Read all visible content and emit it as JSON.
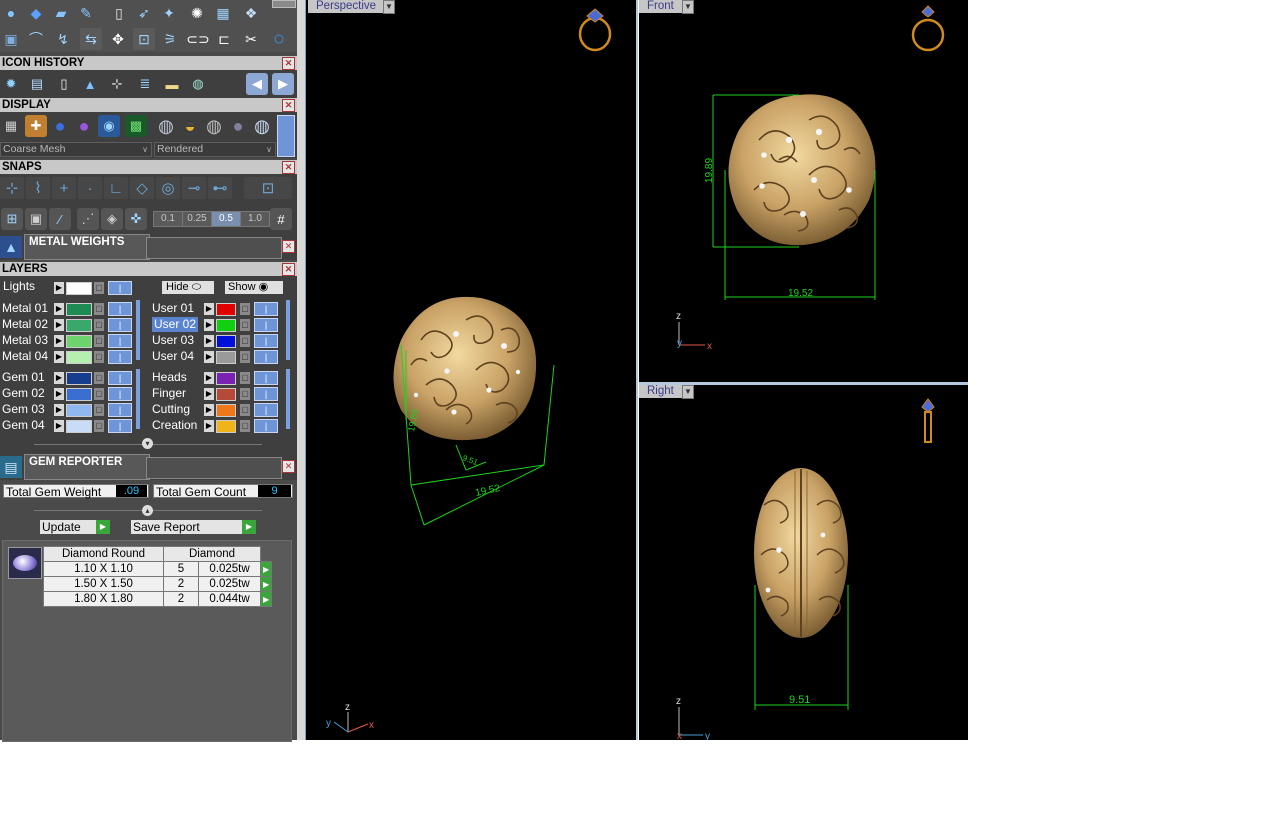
{
  "toolbar_icons": [
    "sphere-icon",
    "gem-icon",
    "blade-icon",
    "pen-icon",
    "page-icon",
    "arrow-icon",
    "wand-icon",
    "flower-icon",
    "calc-icon",
    "network-icon",
    "crop-icon",
    "curve-icon",
    "spline-icon",
    "mirror-icon",
    "move-icon",
    "transform-icon",
    "rays-icon",
    "link-icon",
    "bracket-icon",
    "split-icon",
    "ring-icon"
  ],
  "icon_history": {
    "title": "ICON HISTORY",
    "icons": [
      "gear-icon",
      "barcode-icon",
      "document-icon",
      "pyramid-icon",
      "flow-icon",
      "list-icon",
      "folder-icon",
      "globe-icon"
    ],
    "back_label": "◀",
    "forward_label": "▶"
  },
  "display": {
    "title": "DISPLAY",
    "mesh_value": "Coarse Mesh",
    "render_value": "Rendered"
  },
  "snaps": {
    "title": "SNAPS",
    "values": [
      "0.1",
      "0.25",
      "0.5",
      "1.0"
    ],
    "active_value": "0.5"
  },
  "metal_weights": {
    "title": "METAL WEIGHTS"
  },
  "layers": {
    "title": "LAYERS",
    "lights_label": "Lights",
    "hide_label": "Hide",
    "show_label": "Show",
    "left": [
      {
        "name": "Metal 01",
        "color": "#1e8c52"
      },
      {
        "name": "Metal 02",
        "color": "#3aa86a"
      },
      {
        "name": "Metal 03",
        "color": "#6dd36d"
      },
      {
        "name": "Metal 04",
        "color": "#b6f0b0"
      },
      {
        "name": "Gem 01",
        "color": "#173d8f"
      },
      {
        "name": "Gem 02",
        "color": "#3a6fd1"
      },
      {
        "name": "Gem 03",
        "color": "#8fb7f0"
      },
      {
        "name": "Gem 04",
        "color": "#c8dcf8"
      }
    ],
    "right": [
      {
        "name": "User 01",
        "color": "#e00000",
        "selected": false
      },
      {
        "name": "User 02",
        "color": "#10d010",
        "selected": true
      },
      {
        "name": "User 03",
        "color": "#0010d8",
        "selected": false
      },
      {
        "name": "User 04",
        "color": "#9a9a9a",
        "selected": false
      },
      {
        "name": "Heads",
        "color": "#7a22b4",
        "selected": false
      },
      {
        "name": "Finger",
        "color": "#b54a3a",
        "selected": false
      },
      {
        "name": "Cutting",
        "color": "#f07818",
        "selected": false
      },
      {
        "name": "Creation",
        "color": "#f0b418",
        "selected": false
      }
    ]
  },
  "gem_reporter": {
    "title": "GEM REPORTER",
    "total_weight_label": "Total Gem Weight",
    "total_weight_value": ".09",
    "total_count_label": "Total Gem Count",
    "total_count_value": "9",
    "update_label": "Update",
    "save_label": "Save Report",
    "table": {
      "headers": [
        "Diamond Round",
        "Diamond"
      ],
      "rows": [
        {
          "size": "1.10 X 1.10",
          "count": "5",
          "weight": "0.025tw"
        },
        {
          "size": "1.50 X 1.50",
          "count": "2",
          "weight": "0.025tw"
        },
        {
          "size": "1.80 X 1.80",
          "count": "2",
          "weight": "0.044tw"
        }
      ]
    }
  },
  "viewports": {
    "perspective": {
      "label": "Perspective",
      "dim_a": "19.89",
      "dim_b": "19.52",
      "dim_c": "9.51"
    },
    "front": {
      "label": "Front",
      "dim_height": "19.89",
      "dim_width": "19.52"
    },
    "right": {
      "label": "Right",
      "dim_width": "9.51"
    }
  },
  "axes": {
    "x": "x",
    "y": "y",
    "z": "z"
  },
  "colors": {
    "dimension": "#1ed21e",
    "gold": "#d9b877",
    "viewport_bg": "#000000",
    "panel_bg": "#4a4a4a"
  }
}
